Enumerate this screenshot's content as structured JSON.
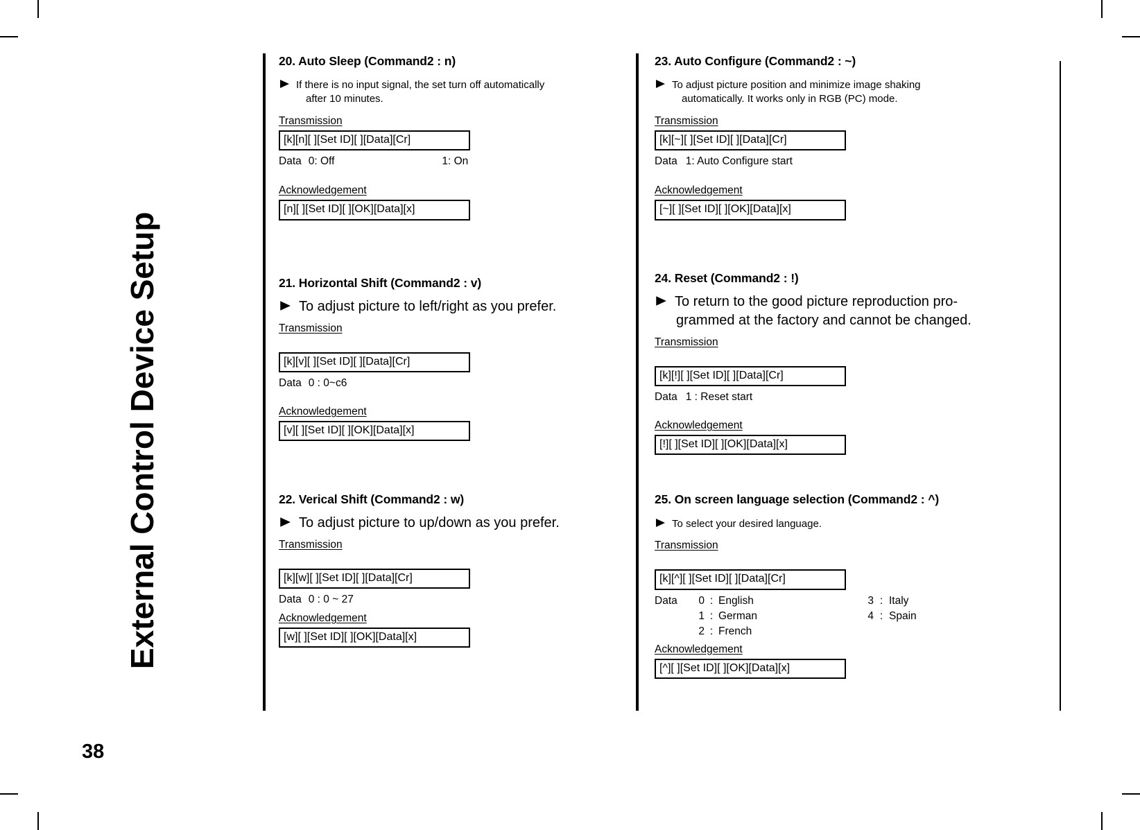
{
  "document": {
    "chapter_title": "External Control Device Setup",
    "page_number": "38"
  },
  "labels": {
    "transmission": "Transmission",
    "acknowledgement": "Acknowledgement",
    "data": "Data"
  },
  "sections": [
    {
      "id": "20",
      "title": "20. Auto Sleep (Command2 : n)",
      "description": "If there is no input signal, the set turn off automatically after 10 minutes.",
      "transmission_label": "Transmission",
      "transmission_code": "[k][n][  ][Set ID][  ][Data][Cr]",
      "data_label": "Data",
      "data_primary": "0: Off",
      "data_secondary": "1: On",
      "ack_label": "Acknowledgement",
      "ack_code": "[n][  ][Set ID][  ][OK][Data][x]"
    },
    {
      "id": "21",
      "title": "21. Horizontal Shift (Command2 : v)",
      "description": "To adjust picture to left/right as you prefer.",
      "transmission_label": "Transmission",
      "transmission_code": "[k][v][  ][Set ID][  ][Data][Cr]",
      "data_label": "Data",
      "data_primary": "0  : 0~c6",
      "ack_label": "Acknowledgement",
      "ack_code": "[v][  ][Set ID][  ][OK][Data][x]"
    },
    {
      "id": "22",
      "title": "22. Verical Shift (Command2 : w)",
      "description": "To adjust picture to up/down as you prefer.",
      "transmission_label": "Transmission",
      "transmission_code": "[k][w][  ][Set ID][  ][Data][Cr]",
      "data_label": "Data",
      "data_primary": "0  : 0 ~ 27",
      "ack_label": "Acknowledgement",
      "ack_code": "[w][  ][Set ID][  ][OK][Data][x]"
    },
    {
      "id": "23",
      "title": "23. Auto Configure (Command2 : ~)",
      "description": "To adjust picture position and minimize image shaking automatically. It works only in RGB (PC) mode.",
      "transmission_label": "Transmission",
      "transmission_code": "[k][~][  ][Set ID][  ][Data][Cr]",
      "data_label": "Data",
      "data_primary": "1: Auto Configure start",
      "ack_label": "Acknowledgement",
      "ack_code": "[~][  ][Set ID][  ][OK][Data][x]"
    },
    {
      "id": "24",
      "title": "24. Reset (Command2 : !)",
      "description": "To return to the good picture reproduction pro-grammed at the factory and cannot be changed.",
      "transmission_label": "Transmission",
      "transmission_code": "[k][!][  ][Set ID][  ][Data][Cr]",
      "data_label": "Data",
      "data_primary": "1 : Reset start",
      "ack_label": "Acknowledgement",
      "ack_code": "[!][  ][Set ID][  ][OK][Data][x]"
    },
    {
      "id": "25",
      "title": "25. On screen language selection (Command2 : ^)",
      "description": "To select your desired language.",
      "transmission_label": "Transmission",
      "transmission_code": "[k][^][  ][Set ID][  ][Data][Cr]",
      "data_label": "Data",
      "languages_left": [
        {
          "code": "0",
          "sep": ":",
          "name": "English"
        },
        {
          "code": "1",
          "sep": ":",
          "name": "German"
        },
        {
          "code": "2",
          "sep": ":",
          "name": "French"
        }
      ],
      "languages_right": [
        {
          "code": "3",
          "sep": ":",
          "name": "Italy"
        },
        {
          "code": "4",
          "sep": ":",
          "name": "Spain"
        }
      ],
      "ack_label": "Acknowledgement",
      "ack_code": "[^][  ][Set ID][  ][OK][Data][x]"
    }
  ],
  "section_24_description_lines": [
    "To return to the good picture reproduction pro-",
    "grammed at the factory and cannot be changed."
  ],
  "section_20_description_lines": [
    "If there is no input signal, the set turn off automatically",
    "after 10 minutes."
  ],
  "section_23_description_lines": [
    "To adjust picture position and minimize image shaking",
    "automatically. It works only in RGB (PC) mode."
  ]
}
